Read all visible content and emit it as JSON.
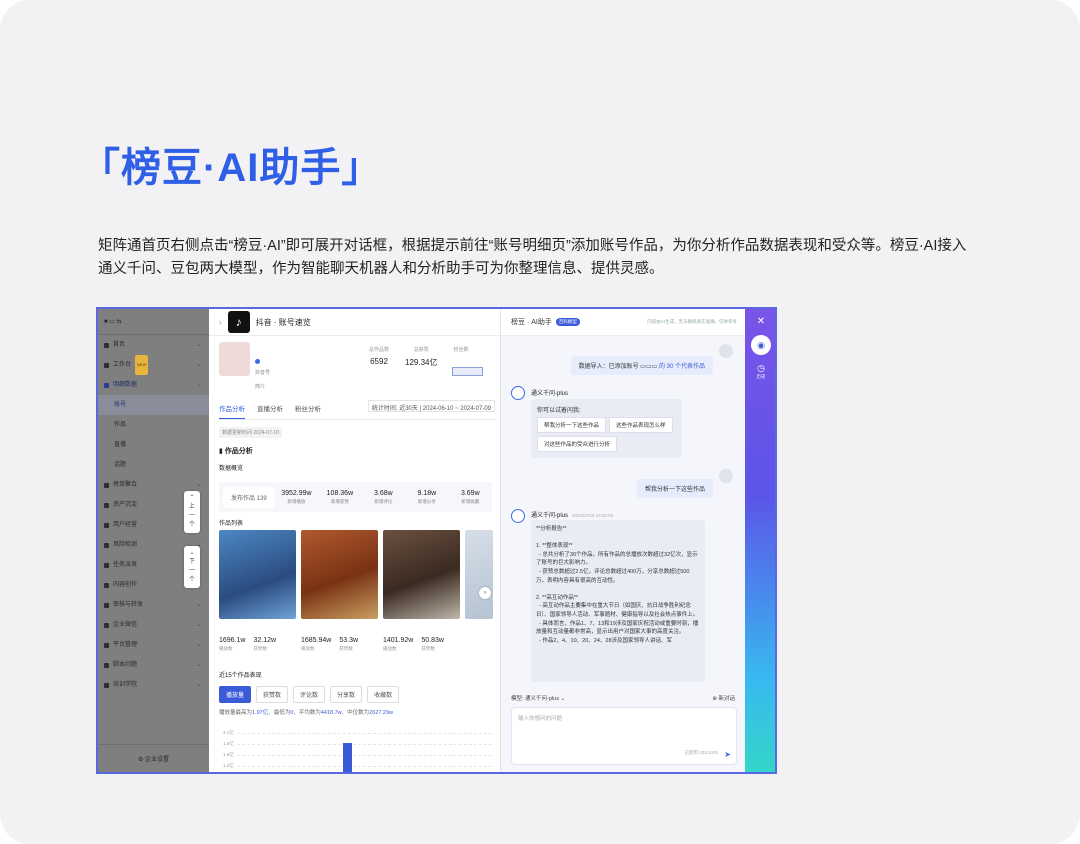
{
  "heading": "「榜豆·AI助手」",
  "description": "矩阵通首页右侧点击“榜豆·AI”即可展开对话框，根据提示前往“账号明细页”添加账号作品，为你分析作品数据表现和受众等。榜豆·AI接入通义千问、豆包两大模型，作为智能聊天机器人和分析助手可为你整理信息、提供灵感。",
  "sidebar": {
    "items": [
      {
        "label": "首页",
        "icon": "home-icon"
      },
      {
        "label": "工作台",
        "icon": "desk-icon",
        "badge": "NEW"
      },
      {
        "label": "明细数据",
        "icon": "data-icon",
        "active": true
      }
    ],
    "subitems": [
      {
        "label": "账号",
        "selected": true
      },
      {
        "label": "作品"
      },
      {
        "label": "直播"
      },
      {
        "label": "话题"
      }
    ],
    "items2": [
      {
        "label": "榜单聚合"
      },
      {
        "label": "资产沉淀"
      },
      {
        "label": "用户经营"
      },
      {
        "label": "风险检测"
      },
      {
        "label": "任务派发"
      },
      {
        "label": "内容创作"
      },
      {
        "label": "审核与转发"
      },
      {
        "label": "企业微信"
      },
      {
        "label": "平台管理"
      },
      {
        "label": "脚本问题"
      },
      {
        "label": "培训学院"
      }
    ],
    "bottom": "企业设置",
    "scroll_up": [
      "上",
      "一",
      "个"
    ],
    "scroll_down": [
      "下",
      "一",
      "个"
    ]
  },
  "main": {
    "title": "抖音 · 账号速览",
    "stats": [
      {
        "label": "总作品数",
        "value": "6592"
      },
      {
        "label": "总获赞",
        "value": "129.34亿"
      },
      {
        "label": "粉丝数",
        "value": ""
      }
    ],
    "account_label": "抖音号",
    "intro_label": "简介",
    "tabs": [
      "作品分析",
      "直播分析",
      "粉丝分析"
    ],
    "date_range": "统计时间: 近30天 | 2024-06-10 ~ 2024-07-09",
    "updated": "数据更新时间 2024-07-10",
    "section_title": "作品分析",
    "overview_title": "数据概览",
    "overview_works": "发布作品 139",
    "overview": [
      {
        "value": "3952.99w",
        "label": "新增播放"
      },
      {
        "value": "108.36w",
        "label": "新增获赞"
      },
      {
        "value": "3.68w",
        "label": "新增评论"
      },
      {
        "value": "9.18w",
        "label": "新增分享"
      },
      {
        "value": "3.69w",
        "label": "新增收藏"
      }
    ],
    "works_title": "作品列表",
    "works": [
      {
        "v1": "1696.1w",
        "l1": "播放数",
        "v2": "32.12w",
        "l2": "获赞数"
      },
      {
        "v1": "1685.94w",
        "l1": "播放数",
        "v2": "53.3w",
        "l2": "获赞数"
      },
      {
        "v1": "1401.92w",
        "l1": "播放数",
        "v2": "50.83w",
        "l2": "获赞数"
      }
    ],
    "recent_title": "近15个作品表现",
    "metric_buttons": [
      "播放量",
      "获赞数",
      "评论数",
      "分享数",
      "收藏数"
    ],
    "note_prefix": "播放量最高为",
    "note_max": "1.97亿",
    "note_mid1": "、最低为",
    "note_min": "0",
    "note_mid2": "、平均数为",
    "note_avg": "4418.7w",
    "note_mid3": "、中位数为",
    "note_median": "2627.29w",
    "y_ticks": [
      "2.1亿",
      "1.8亿",
      "1.5亿",
      "1.2亿"
    ]
  },
  "chat": {
    "title": "榜豆 · AI助手",
    "tag": "百科模型",
    "tip": "内容由AI生成，无法确保真实准确，仅供参考",
    "msg1_prefix": "数据导入：已添加账号",
    "msg1_suffix": "的 30 个代表作品",
    "bot_name": "通义千问-plus",
    "try_label": "你可以试着问我:",
    "suggestions": [
      "帮我分析一下这些作品",
      "这些作品表现怎么样",
      "对这些作品的受众进行分析"
    ],
    "msg2": "帮我分析一下这些作品",
    "bot_time": "2024/07/10 14:56:03",
    "report": "**分析报告**\n\n1. **整体表现**\n  - 总共分析了30个作品，所有作品的总播放次数超过32亿次，显示了账号的巨大影响力。\n  - 获赞总数超过2.5亿，评论总数超过400万，分享总数超过500万，表明内容具有很高的互动性。\n\n2. **高互动作品**\n  - 高互动作品主要集中在重大节日（如国庆、抗日战争胜利纪念日）、国家领导人活动、军事题材、健康指导以及社会热点事件上。\n  - 具体而言，作品1、7、13和19涉及国家庆祝活动或重要时刻，播放量和互动量都非常高，显示出用户对国家大事的高度关注。\n  - 作品2、4、10、20、24、28涉及国家领导人讲话、军",
    "model_label": "模型: 通义千问-plus",
    "new_chat": "新对话",
    "input_placeholder": "输入你想问的问题",
    "char_count": "已使用 231/1000",
    "history_label": "历史"
  },
  "colors": {
    "accent": "#2f5fe6",
    "rail_top": "#7b53e8",
    "rail_bottom": "#34d6c8"
  }
}
